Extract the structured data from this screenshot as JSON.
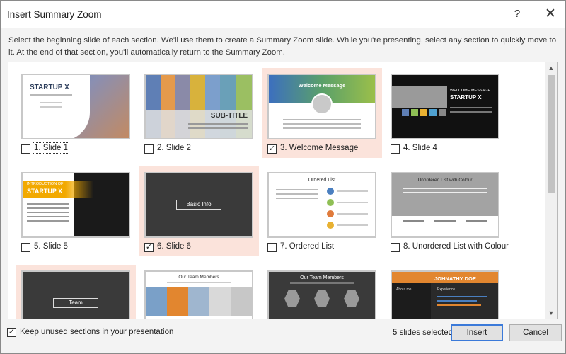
{
  "dialog": {
    "title": "Insert Summary Zoom",
    "help_glyph": "?",
    "close_glyph": "✕",
    "description": "Select the beginning slide of each section. We'll use them to create a Summary Zoom slide. While you're presenting, select any section to quickly move to it. At the end of that section, you'll automatically return to the Summary Zoom."
  },
  "slides": [
    {
      "label": "1. Slide 1",
      "checked": false
    },
    {
      "label": "2. Slide 2",
      "checked": false
    },
    {
      "label": "3. Welcome Message",
      "checked": true
    },
    {
      "label": "4. Slide 4",
      "checked": false
    },
    {
      "label": "5. Slide 5",
      "checked": false
    },
    {
      "label": "6. Slide 6",
      "checked": true
    },
    {
      "label": "7. Ordered List",
      "checked": false
    },
    {
      "label": "8. Unordered List with Colour",
      "checked": false
    },
    {
      "label": "",
      "checked": true
    },
    {
      "label": "",
      "checked": false
    },
    {
      "label": "",
      "checked": false
    },
    {
      "label": "",
      "checked": false
    }
  ],
  "thumbs": {
    "s1_title": "STARTUP X",
    "s2_subtitle": "SUB-TITLE",
    "s3_title": "Welcome Message",
    "s4_title1": "WELCOME MESSAGE",
    "s4_title2": "STARTUP X",
    "s5_title1": "INTRODUCTION OF",
    "s5_title2": "STARTUP X",
    "s6_box": "Basic Info",
    "s7_title": "Ordered List",
    "s8_title": "Unordered List with Colour",
    "s9_box": "Team",
    "s10_title": "Our Team Members",
    "s11_title": "Our Team Members",
    "s12_title": "JOHNATHY DOE",
    "s12_sub1": "About me",
    "s12_sub2": "Experience"
  },
  "footer": {
    "keep_unused_label": "Keep unused sections in your presentation",
    "keep_unused_checked": true,
    "selected_count": "5 slides selected",
    "insert_label": "Insert",
    "cancel_label": "Cancel"
  },
  "colors": {
    "selected_bg": "#fbe3db",
    "focus_border": "#3b7ad9"
  }
}
